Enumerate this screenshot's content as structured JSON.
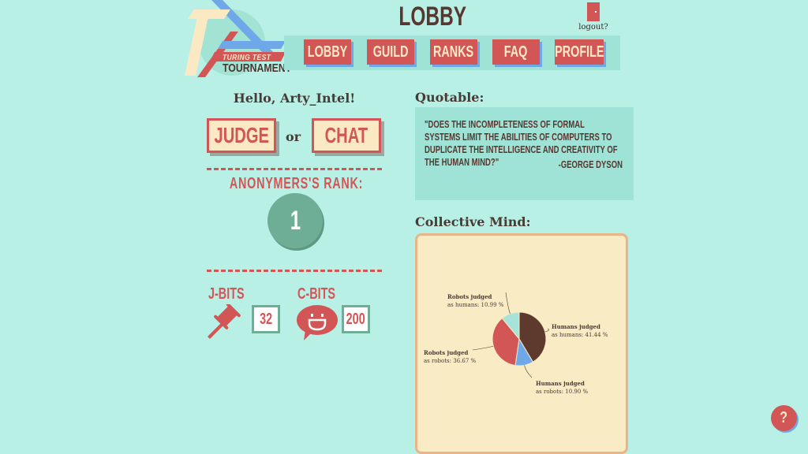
{
  "logo": {
    "subtitle": "TURING TEST",
    "title": "TOURNAMENT"
  },
  "header": {
    "title": "LOBBY",
    "logout_label": "logout?"
  },
  "nav": {
    "items": [
      {
        "label": "LOBBY"
      },
      {
        "label": "GUILD"
      },
      {
        "label": "RANKS"
      },
      {
        "label": "FAQ"
      },
      {
        "label": "PROFILE"
      }
    ]
  },
  "left": {
    "greeting": "Hello, Arty_Intel!",
    "judge_label": "JUDGE",
    "or_label": "or",
    "chat_label": "CHAT",
    "rank_label": "ANONYMERS'S RANK:",
    "rank_value": "1",
    "jbits_label": "J-BITS",
    "jbits_value": "32",
    "cbits_label": "C-BITS",
    "cbits_value": "200"
  },
  "quotable": {
    "heading": "Quotable:",
    "text": "\"Does the incompleteness of formal systems limit the abilities of computers to duplicate the intelligence and creativity of the human mind?\"",
    "author": "-George Dyson"
  },
  "collective": {
    "heading": "Collective Mind:"
  },
  "help": {
    "label": "?"
  },
  "colors": {
    "background": "#b8f0e6",
    "accent_red": "#d35656",
    "cream": "#fbe9c4",
    "teal_panel": "#9fe3d6",
    "green": "#6fae96",
    "blue_shadow": "#6fa8e8",
    "dark_brown": "#5a3630"
  },
  "chart_data": {
    "type": "pie",
    "title": "Collective Mind",
    "slices": [
      {
        "label": "Humans judged as humans",
        "value": 41.44,
        "display": "Humans judged|as humans: 41.44 %",
        "color": "#5e3a2e"
      },
      {
        "label": "Humans judged as robots",
        "value": 10.9,
        "display": "Humans judged|as robots: 10.90 %",
        "color": "#6fa8e8"
      },
      {
        "label": "Robots judged as robots",
        "value": 36.67,
        "display": "Robots judged|as robots: 36.67 %",
        "color": "#d35656"
      },
      {
        "label": "Robots judged as humans",
        "value": 10.99,
        "display": "Robots judged|as humans: 10.99 %",
        "color": "#a7e3d8"
      }
    ],
    "unit": "%"
  }
}
